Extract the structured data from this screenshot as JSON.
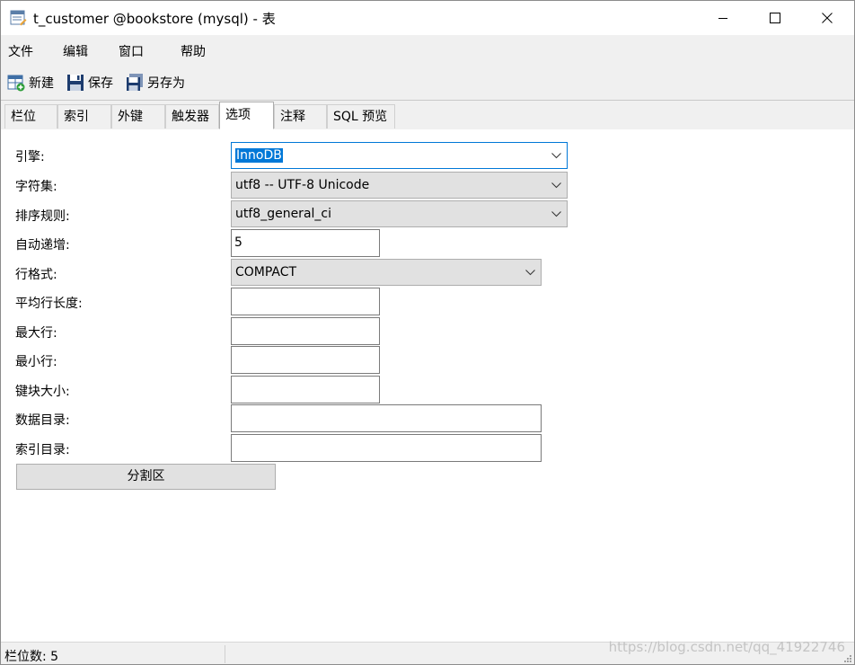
{
  "window": {
    "title": "t_customer @bookstore (mysql) - 表",
    "app_icon": "table-design-icon",
    "controls": [
      "minimize-icon",
      "maximize-icon",
      "close-icon"
    ]
  },
  "menu": [
    "文件",
    "编辑",
    "窗口",
    "帮助"
  ],
  "toolbar": [
    {
      "label": "新建",
      "icon": "new-table-icon"
    },
    {
      "label": "保存",
      "icon": "save-icon"
    },
    {
      "label": "另存为",
      "icon": "save-as-icon"
    }
  ],
  "tabs": [
    "栏位",
    "索引",
    "外键",
    "触发器",
    "选项",
    "注释",
    "SQL 预览"
  ],
  "active_tab": "选项",
  "options": {
    "engine": {
      "label": "引擎:",
      "value": "InnoDB"
    },
    "charset": {
      "label": "字符集:",
      "value": "utf8 -- UTF-8 Unicode"
    },
    "collation": {
      "label": "排序规则:",
      "value": "utf8_general_ci"
    },
    "auto_increment": {
      "label": "自动递增:",
      "value": "5"
    },
    "row_format": {
      "label": "行格式:",
      "value": "COMPACT"
    },
    "avg_row_length": {
      "label": "平均行长度:",
      "value": ""
    },
    "max_rows": {
      "label": "最大行:",
      "value": ""
    },
    "min_rows": {
      "label": "最小行:",
      "value": ""
    },
    "key_block_size": {
      "label": "键块大小:",
      "value": ""
    },
    "data_directory": {
      "label": "数据目录:",
      "value": ""
    },
    "index_directory": {
      "label": "索引目录:",
      "value": ""
    },
    "partition_button": "分割区"
  },
  "status": {
    "field_count": "栏位数: 5",
    "watermark": "https://blog.csdn.net/qq_41922746"
  },
  "colors": {
    "accent": "#0078d7",
    "chrome": "#f0f0f0",
    "control": "#e1e1e1"
  }
}
